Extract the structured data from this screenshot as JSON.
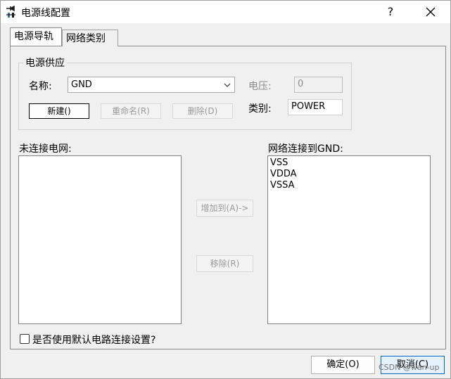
{
  "window": {
    "title": "电源线配置",
    "help": "?"
  },
  "tabs": [
    {
      "label": "电源导轨"
    },
    {
      "label": "网络类别"
    }
  ],
  "power_supply": {
    "group_title": "电源供应",
    "name_label": "名称:",
    "name_value": "GND",
    "voltage_label": "电压:",
    "voltage_value": "0",
    "new_button": "新建()",
    "rename_button": "重命名(R)",
    "delete_button": "删除(D)",
    "category_label": "类别:",
    "category_value": "POWER"
  },
  "unconnected": {
    "label": "未连接电网:",
    "items": []
  },
  "connected": {
    "label": "网络连接到GND:",
    "items": [
      "VSS",
      "VDDA",
      "VSSA"
    ]
  },
  "add_button": "增加到(A)->",
  "remove_button": "移除(R)",
  "default_setting_label": "是否使用默认电路连接设置?",
  "ok_button": "确定(O)",
  "cancel_button": "取消(C)",
  "watermark": "CSDN @wan-up"
}
